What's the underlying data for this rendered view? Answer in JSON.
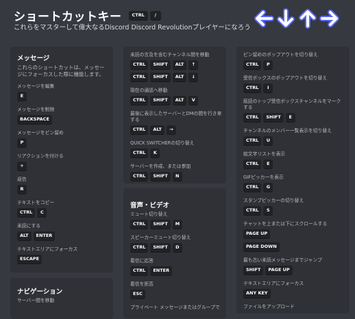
{
  "header": {
    "title": "ショートカットキー",
    "title_keys": [
      "CTRL",
      "/"
    ],
    "subtitle": "これらをマスターして偉大なるDiscord Discord Revolutionプレイヤーになろう"
  },
  "col1": {
    "message": {
      "title": "メッセージ",
      "desc": "これらのショートカットは、メッセージにフォーカスした際に機能します。",
      "items": [
        {
          "label": "メッセージを編集",
          "keys": [
            "E"
          ]
        },
        {
          "label": "メッセージを削除",
          "keys": [
            "BACKSPACE"
          ]
        },
        {
          "label": "メッセージをピン留め",
          "keys": [
            "P"
          ]
        },
        {
          "label": "リアクションを付ける",
          "keys": [
            "+"
          ]
        },
        {
          "label": "返信",
          "keys": [
            "R"
          ]
        },
        {
          "label": "テキストをコピー",
          "keys": [
            "CTRL",
            "C"
          ]
        },
        {
          "label": "未読にする",
          "keys": [
            "ALT",
            "ENTER"
          ]
        },
        {
          "label": "テキストエリアにフォーカス",
          "keys": [
            "ESCAPE"
          ]
        }
      ]
    },
    "navigation": {
      "title": "ナビゲーション",
      "items": [
        {
          "label": "サーバー間を移動"
        }
      ]
    }
  },
  "col2": {
    "items1": [
      {
        "label": "未読の言及を含むチャンネル間を移動",
        "keys": [
          "CTRL",
          "SHIFT",
          "ALT",
          "↑"
        ]
      },
      {
        "label": "",
        "keys": [
          "CTRL",
          "SHIFT",
          "ALT",
          "↓"
        ]
      },
      {
        "label": "現在の通話へ移動",
        "keys": [
          "CTRL",
          "SHIFT",
          "ALT",
          "V"
        ]
      },
      {
        "label": "最後に表示したサーバーとDMの間を行き来する",
        "keys": [
          "CTRL",
          "ALT",
          "→"
        ]
      },
      {
        "label": "QUICK SWITCHERの切り替え",
        "keys": [
          "CTRL",
          "K"
        ]
      },
      {
        "label": "サーバーを作成、または参加",
        "keys": [
          "CTRL",
          "SHIFT",
          "N"
        ]
      }
    ],
    "voice": {
      "title": "音声・ビデオ",
      "items": [
        {
          "label": "ミュート切り替え",
          "keys": [
            "CTRL",
            "SHIFT",
            "M"
          ]
        },
        {
          "label": "スピーカーミュート切り替え",
          "keys": [
            "CTRL",
            "SHIFT",
            "D"
          ]
        },
        {
          "label": "着信に応答",
          "keys": [
            "CTRL",
            "ENTER"
          ]
        },
        {
          "label": "着信を拒否",
          "keys": [
            "ESC"
          ]
        },
        {
          "label": "プライベート メッセージまたはグループで"
        }
      ]
    }
  },
  "col3": {
    "items": [
      {
        "label": "ピン留めのポップアウトを切り替え",
        "keys": [
          "CTRL",
          "P"
        ]
      },
      {
        "label": "受信ボックスのポップアウトを切り替え",
        "keys": [
          "CTRL",
          "I"
        ]
      },
      {
        "label": "既読のトップ受信ボックスチャンネルをマークする",
        "keys": [
          "CTRL",
          "SHIFT",
          "E"
        ]
      },
      {
        "label": "チャンネルのメンバー一覧表示を切り替え",
        "keys": [
          "CTRL",
          "U"
        ]
      },
      {
        "label": "絵文字リストを表示",
        "keys": [
          "CTRL",
          "E"
        ]
      },
      {
        "label": "GIFピッカーを表示",
        "keys": [
          "CTRL",
          "G"
        ]
      },
      {
        "label": "スタンプピッカーの切り替え",
        "keys": [
          "CTRL",
          "S"
        ]
      },
      {
        "label": "チャットを上または下にスクロールする",
        "keys": [
          "PAGE UP"
        ]
      },
      {
        "label": "",
        "keys": [
          "PAGE DOWN"
        ]
      },
      {
        "label": "最も古い未読メッセージまでジャンプ",
        "keys": [
          "SHIFT",
          "PAGE UP"
        ]
      },
      {
        "label": "テキストエリアにフォーカス",
        "keys": [
          "ANY KEY"
        ]
      },
      {
        "label": "ファイルをアップロード"
      }
    ]
  },
  "icons": {
    "arrows": [
      "left-arrow-icon",
      "down-arrow-icon",
      "up-arrow-icon",
      "right-arrow-icon"
    ]
  }
}
